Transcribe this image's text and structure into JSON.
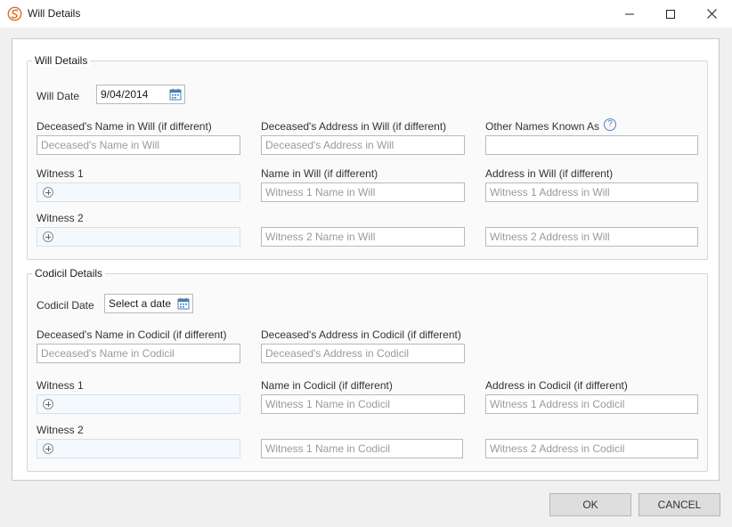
{
  "window": {
    "title": "Will Details",
    "icon": "app-logo-icon",
    "controls": {
      "minimize": "minimize-icon",
      "maximize": "maximize-icon",
      "close": "close-icon"
    }
  },
  "will": {
    "section_title": "Will Details",
    "date_label": "Will Date",
    "date_value": "9/04/2014",
    "deceased_name_label": "Deceased's Name in Will (if different)",
    "deceased_name_placeholder": "Deceased's Name in Will",
    "deceased_address_label": "Deceased's Address in Will (if different)",
    "deceased_address_placeholder": "Deceased's Address in Will",
    "other_names_label": "Other Names Known As",
    "help_glyph": "?",
    "witness1_label": "Witness 1",
    "name_in_will_label": "Name in Will (if different)",
    "address_in_will_label": "Address in Will (if different)",
    "witness1_name_placeholder": "Witness 1 Name in Will",
    "witness1_address_placeholder": "Witness 1 Address in Will",
    "witness2_label": "Witness 2",
    "witness2_name_placeholder": "Witness 2 Name in Will",
    "witness2_address_placeholder": "Witness 2 Address in Will"
  },
  "codicil": {
    "section_title": "Codicil Details",
    "date_label": "Codicil Date",
    "date_placeholder": "Select a date",
    "deceased_name_label": "Deceased's Name in Codicil (if different)",
    "deceased_name_placeholder": "Deceased's Name in Codicil",
    "deceased_address_label": "Deceased's Address in Codicil (if different)",
    "deceased_address_placeholder": "Deceased's Address in Codicil",
    "witness1_label": "Witness 1",
    "name_in_codicil_label": "Name in Codicil (if different)",
    "address_in_codicil_label": "Address in Codicil (if different)",
    "witness1_name_placeholder": "Witness 1 Name in Codicil",
    "witness1_address_placeholder": "Witness 1 Address in Codicil",
    "witness2_label": "Witness 2",
    "witness2_name_placeholder": "Witness 1 Name in Codicil",
    "witness2_address_placeholder": "Witness 2 Address in Codicil"
  },
  "buttons": {
    "ok": "OK",
    "cancel": "CANCEL"
  },
  "colors": {
    "accent": "#e06a2c",
    "help_icon": "#5a7fb8",
    "calendar_icon": "#4a7bb5",
    "witness_border": "#cfe3f2"
  }
}
